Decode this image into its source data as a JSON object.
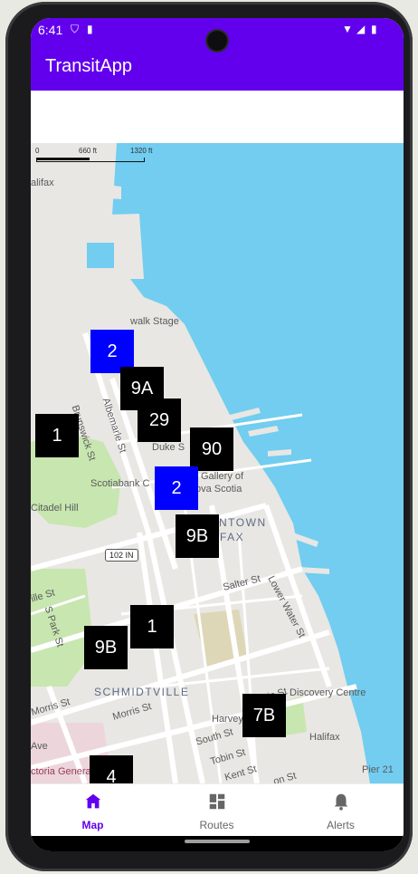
{
  "status": {
    "time": "6:41"
  },
  "app": {
    "title": "TransitApp"
  },
  "map": {
    "scale": {
      "zero": "0",
      "mid": "660 ft",
      "end": "1320 ft"
    },
    "labels": {
      "halifax_top": "alifax",
      "boardwalk": "walk Stage",
      "brunswick": "Brunswick St",
      "albemarle": "Albemarle St",
      "duke": "Duke S",
      "scotiabank": "Scotiabank C",
      "gallery1": "Gallery of",
      "gallery2": "ova Scotia",
      "downtown1": "NTOWN",
      "downtown2": "LIFAX",
      "citadel": "Citadel Hill",
      "highway": "102 IN",
      "salter": "Salter St",
      "lower_water": "Lower Water St",
      "sackville": "ille St",
      "spark": "S Park St",
      "schmidtville": "SCHMIDTVILLE",
      "morris1": "Morris St",
      "morris2": "Morris St",
      "harvey": "Harvey",
      "discovery": "Discovery Centre",
      "halifax_station": "Halifax",
      "south": "South St",
      "tobin": "Tobin St",
      "kent": "Kent St",
      "ave": "Ave",
      "victoria": "ctoria Genera",
      "pier": "Pier 21",
      "on_st": "on St"
    }
  },
  "markers": [
    {
      "label": "2",
      "color": "blue"
    },
    {
      "label": "9A",
      "color": "black"
    },
    {
      "label": "29",
      "color": "black"
    },
    {
      "label": "1",
      "color": "black"
    },
    {
      "label": "90",
      "color": "black"
    },
    {
      "label": "2",
      "color": "blue"
    },
    {
      "label": "9B",
      "color": "black"
    },
    {
      "label": "1",
      "color": "black"
    },
    {
      "label": "9B",
      "color": "black"
    },
    {
      "label": "7B",
      "color": "black"
    },
    {
      "label": "4",
      "color": "black"
    }
  ],
  "nav": {
    "items": [
      {
        "label": "Map",
        "icon": "home-icon",
        "active": true
      },
      {
        "label": "Routes",
        "icon": "dashboard-icon",
        "active": false
      },
      {
        "label": "Alerts",
        "icon": "bell-icon",
        "active": false
      }
    ]
  },
  "colors": {
    "primary": "#6200ee",
    "water": "#72cdf0",
    "park": "#c8e6b0",
    "blue_marker": "#0000ff"
  }
}
